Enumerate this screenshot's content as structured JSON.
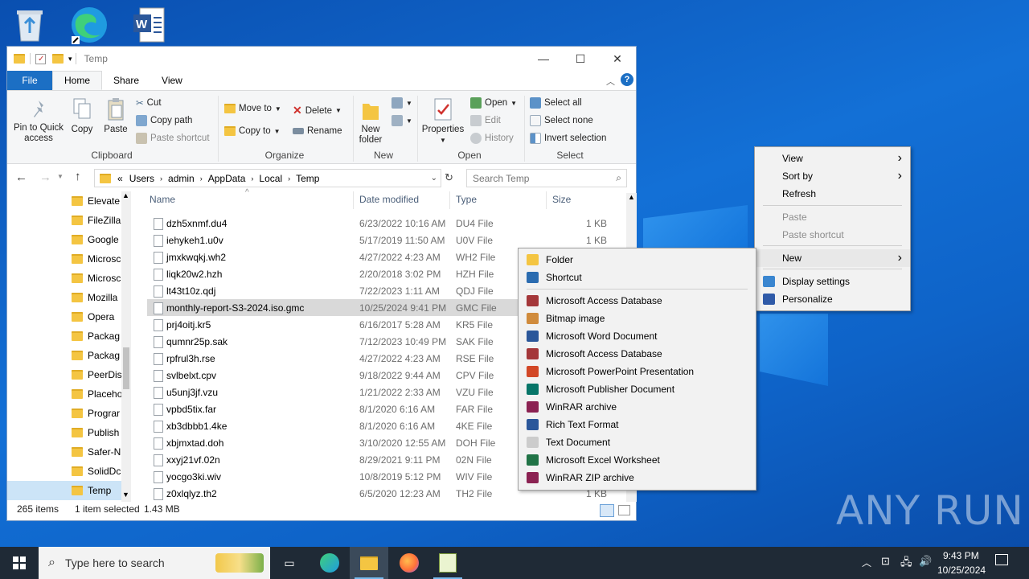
{
  "desktop": {
    "icons": [
      "recycle-bin-icon",
      "edge-icon",
      "word-icon"
    ],
    "watermark": "ANY RUN"
  },
  "explorer": {
    "title": "Temp",
    "window_controls": {
      "minimize": "—",
      "maximize": "☐",
      "close": "✕"
    },
    "tabs": [
      "File",
      "Home",
      "Share",
      "View"
    ],
    "ribbon": {
      "clipboard": {
        "pin": "Pin to Quick access",
        "copy": "Copy",
        "paste": "Paste",
        "cut": "Cut",
        "copy_path": "Copy path",
        "paste_shortcut": "Paste shortcut",
        "label": "Clipboard"
      },
      "organize": {
        "move_to": "Move to",
        "copy_to": "Copy to",
        "delete": "Delete",
        "rename": "Rename",
        "label": "Organize"
      },
      "new": {
        "new_folder": "New folder",
        "label": "New"
      },
      "open": {
        "properties": "Properties",
        "open": "Open",
        "edit": "Edit",
        "history": "History",
        "label": "Open"
      },
      "select": {
        "select_all": "Select all",
        "select_none": "Select none",
        "invert": "Invert selection",
        "label": "Select"
      }
    },
    "address": {
      "prefix": "«",
      "crumbs": [
        "Users",
        "admin",
        "AppData",
        "Local",
        "Temp"
      ],
      "search_placeholder": "Search Temp"
    },
    "nav_items": [
      "Elevate",
      "FileZilla",
      "Google",
      "Microsc",
      "Microsc",
      "Mozilla",
      "Opera",
      "Packag",
      "Packag",
      "PeerDis",
      "Placeho",
      "Prograr",
      "Publish",
      "Safer-N",
      "SolidDc",
      "Temp"
    ],
    "columns": {
      "name": "Name",
      "date": "Date modified",
      "type": "Type",
      "size": "Size"
    },
    "files": [
      {
        "name": "dzh5xnmf.du4",
        "date": "6/23/2022 10:16 AM",
        "type": "DU4 File",
        "size": "1 KB"
      },
      {
        "name": "iehykeh1.u0v",
        "date": "5/17/2019 11:50 AM",
        "type": "U0V File",
        "size": "1 KB"
      },
      {
        "name": "jmxkwqkj.wh2",
        "date": "4/27/2022 4:23 AM",
        "type": "WH2 File",
        "size": ""
      },
      {
        "name": "liqk20w2.hzh",
        "date": "2/20/2018 3:02 PM",
        "type": "HZH File",
        "size": ""
      },
      {
        "name": "lt43t10z.qdj",
        "date": "7/22/2023 1:11 AM",
        "type": "QDJ File",
        "size": ""
      },
      {
        "name": "monthly-report-S3-2024.iso.gmc",
        "date": "10/25/2024 9:41 PM",
        "type": "GMC File",
        "size": ""
      },
      {
        "name": "prj4oitj.kr5",
        "date": "6/16/2017 5:28 AM",
        "type": "KR5 File",
        "size": ""
      },
      {
        "name": "qumnr25p.sak",
        "date": "7/12/2023 10:49 PM",
        "type": "SAK File",
        "size": ""
      },
      {
        "name": "rpfrul3h.rse",
        "date": "4/27/2022 4:23 AM",
        "type": "RSE File",
        "size": ""
      },
      {
        "name": "svlbelxt.cpv",
        "date": "9/18/2022 9:44 AM",
        "type": "CPV File",
        "size": ""
      },
      {
        "name": "u5unj3jf.vzu",
        "date": "1/21/2022 2:33 AM",
        "type": "VZU File",
        "size": ""
      },
      {
        "name": "vpbd5tix.far",
        "date": "8/1/2020 6:16 AM",
        "type": "FAR File",
        "size": ""
      },
      {
        "name": "xb3dbbb1.4ke",
        "date": "8/1/2020 6:16 AM",
        "type": "4KE File",
        "size": ""
      },
      {
        "name": "xbjmxtad.doh",
        "date": "3/10/2020 12:55 AM",
        "type": "DOH File",
        "size": ""
      },
      {
        "name": "xxyj21vf.02n",
        "date": "8/29/2021 9:11 PM",
        "type": "02N File",
        "size": ""
      },
      {
        "name": "yocgo3ki.wiv",
        "date": "10/8/2019 5:12 PM",
        "type": "WIV File",
        "size": ""
      },
      {
        "name": "z0xlqlyz.th2",
        "date": "6/5/2020 12:23 AM",
        "type": "TH2 File",
        "size": "1 KB"
      }
    ],
    "selected_index": 5,
    "status": {
      "count": "265 items",
      "selection": "1 item selected",
      "size": "1.43 MB"
    }
  },
  "context_menu": {
    "items": [
      {
        "label": "View",
        "submenu": true,
        "disabled": false
      },
      {
        "label": "Sort by",
        "submenu": true,
        "disabled": false
      },
      {
        "label": "Refresh",
        "submenu": false,
        "disabled": false
      },
      {
        "label": "Paste",
        "submenu": false,
        "disabled": true
      },
      {
        "label": "Paste shortcut",
        "submenu": false,
        "disabled": true
      },
      {
        "label": "New",
        "submenu": true,
        "disabled": false
      },
      {
        "label": "Display settings",
        "submenu": false,
        "disabled": false
      },
      {
        "label": "Personalize",
        "submenu": false,
        "disabled": false
      }
    ]
  },
  "new_submenu": {
    "items": [
      {
        "label": "Folder",
        "icon": "folder-icon",
        "color": "#f4c542"
      },
      {
        "label": "Shortcut",
        "icon": "shortcut-icon",
        "color": "#2b6cb0"
      },
      {
        "label": "Microsoft Access Database",
        "icon": "access-icon",
        "color": "#a4373a"
      },
      {
        "label": "Bitmap image",
        "icon": "bitmap-icon",
        "color": "#d08b3c"
      },
      {
        "label": "Microsoft Word Document",
        "icon": "word-icon",
        "color": "#2b579a"
      },
      {
        "label": "Microsoft Access Database",
        "icon": "access-icon",
        "color": "#a4373a"
      },
      {
        "label": "Microsoft PowerPoint Presentation",
        "icon": "powerpoint-icon",
        "color": "#d24726"
      },
      {
        "label": "Microsoft Publisher Document",
        "icon": "publisher-icon",
        "color": "#077568"
      },
      {
        "label": "WinRAR archive",
        "icon": "winrar-icon",
        "color": "#8b2252"
      },
      {
        "label": "Rich Text Format",
        "icon": "rtf-icon",
        "color": "#2b579a"
      },
      {
        "label": "Text Document",
        "icon": "text-document-icon",
        "color": "#cccccc"
      },
      {
        "label": "Microsoft Excel Worksheet",
        "icon": "excel-icon",
        "color": "#217346"
      },
      {
        "label": "WinRAR ZIP archive",
        "icon": "winrar-zip-icon",
        "color": "#8b2252"
      }
    ]
  },
  "taskbar": {
    "search_placeholder": "Type here to search",
    "time": "9:43 PM",
    "date": "10/25/2024",
    "apps": [
      "task-view-icon",
      "edge-icon",
      "file-explorer-icon",
      "firefox-icon",
      "notepadpp-icon"
    ]
  }
}
